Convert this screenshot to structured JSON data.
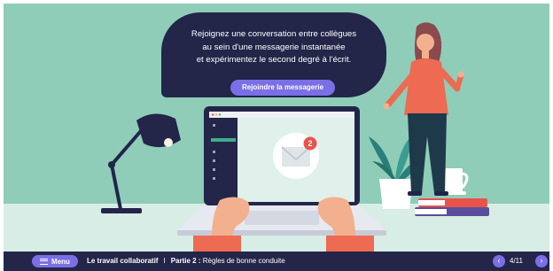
{
  "bubble": {
    "lines": [
      "Rejoignez une conversation entre collègues",
      "au sein d'une messagerie instantanée",
      "et expérimentez le second degré à l'écrit."
    ],
    "button_label": "Rejoindre la messagerie"
  },
  "screen": {
    "notification_count": "2"
  },
  "bottombar": {
    "menu_label": "Menu",
    "module_title": "Le travail collaboratif",
    "separator": "I",
    "part_label": "Partie 2 :",
    "part_title": "Règles de bonne conduite",
    "page_counter": "4/11",
    "prev_icon": "chevron-left-icon",
    "next_icon": "chevron-right-icon"
  },
  "colors": {
    "background": "#8fcdb8",
    "navy": "#232549",
    "accent": "#7b6fe6",
    "notification": "#e9524a"
  }
}
